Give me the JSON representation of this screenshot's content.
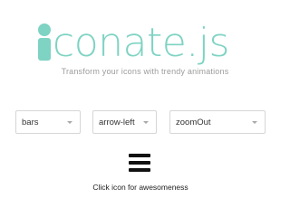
{
  "header": {
    "logo_text": "conate.js",
    "tagline": "Transform your icons with trendy animations"
  },
  "controls": {
    "icon_select": {
      "value": "bars"
    },
    "from_select": {
      "value": "arrow-left"
    },
    "animation_select": {
      "value": "zoomOut"
    }
  },
  "demo": {
    "icon": "bars-icon",
    "caption": "Click icon for awesomeness"
  },
  "colors": {
    "brand": "#7ed3c3",
    "text_muted": "#9c9c9c",
    "border": "#d6d6d6",
    "icon": "#111111"
  }
}
